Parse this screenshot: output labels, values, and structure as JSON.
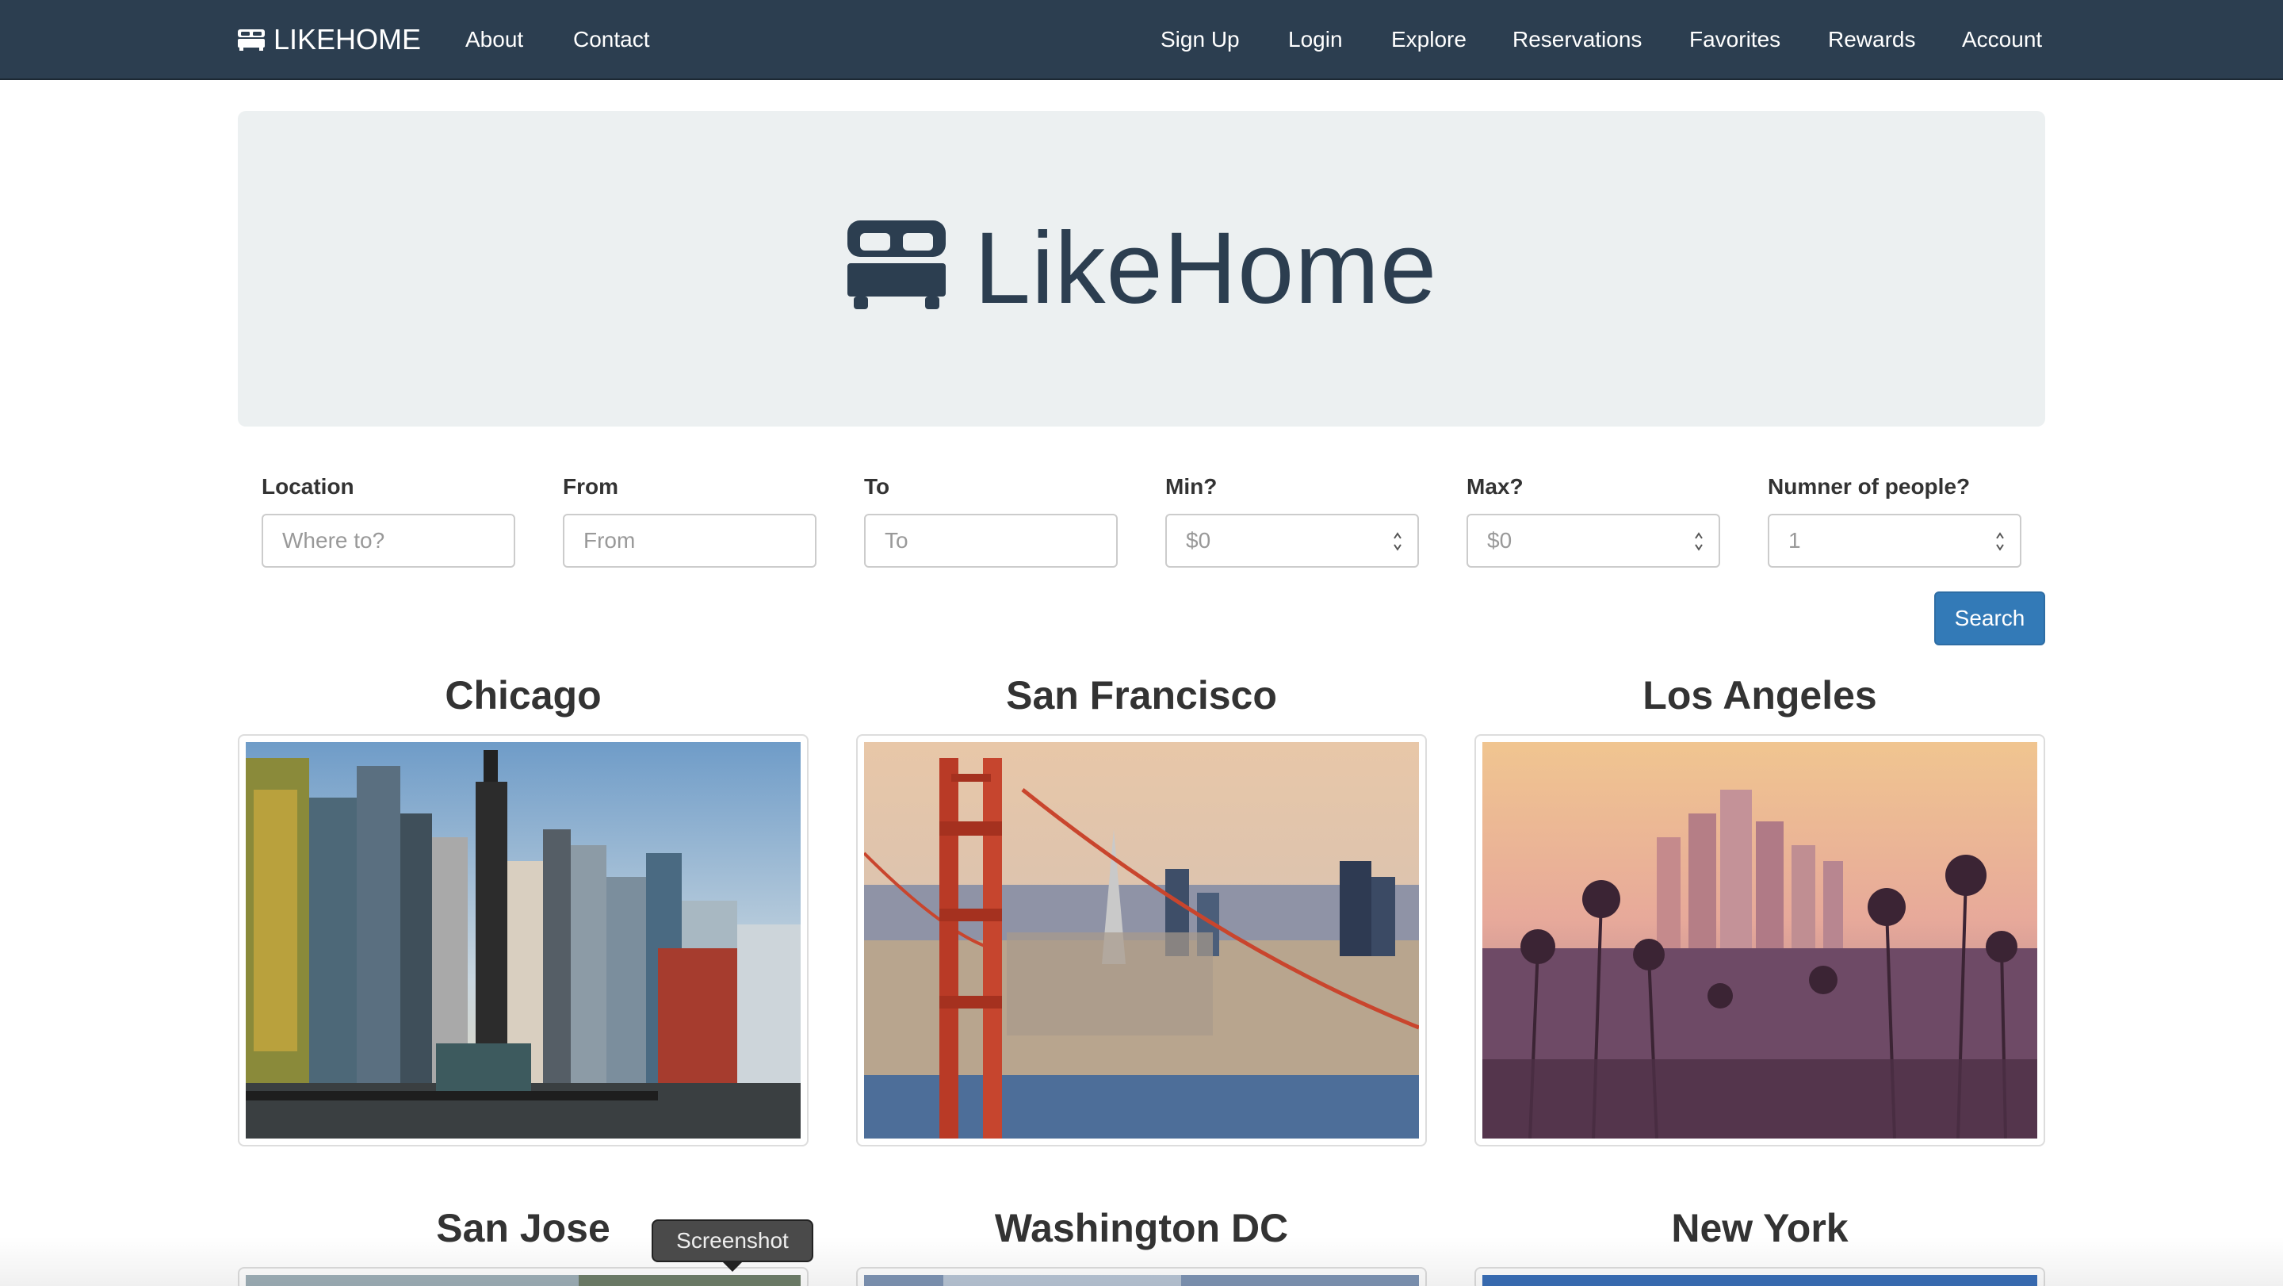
{
  "navbar": {
    "brand": "LIKEHOME",
    "left_links": [
      "About",
      "Contact"
    ],
    "right_links": [
      "Sign Up",
      "Login",
      "Explore",
      "Reservations",
      "Favorites",
      "Rewards",
      "Account"
    ],
    "bg_color": "#2c3e50"
  },
  "hero": {
    "title": "LikeHome",
    "icon": "bed-icon",
    "bg_color": "#ecf0f1"
  },
  "search_form": {
    "fields": [
      {
        "label": "Location",
        "placeholder": "Where to?",
        "type": "text"
      },
      {
        "label": "From",
        "placeholder": "From",
        "type": "text"
      },
      {
        "label": "To",
        "placeholder": "To",
        "type": "text"
      },
      {
        "label": "Min?",
        "placeholder": "$0",
        "type": "number"
      },
      {
        "label": "Max?",
        "placeholder": "$0",
        "type": "number"
      },
      {
        "label": "Numner of people?",
        "placeholder": "1",
        "type": "number"
      }
    ],
    "submit_label": "Search",
    "submit_color": "#337ab7"
  },
  "cities": [
    {
      "name": "Chicago"
    },
    {
      "name": "San Francisco"
    },
    {
      "name": "Los Angeles"
    },
    {
      "name": "San Jose"
    },
    {
      "name": "Washington DC"
    },
    {
      "name": "New York"
    }
  ],
  "tooltip": "Screenshot"
}
